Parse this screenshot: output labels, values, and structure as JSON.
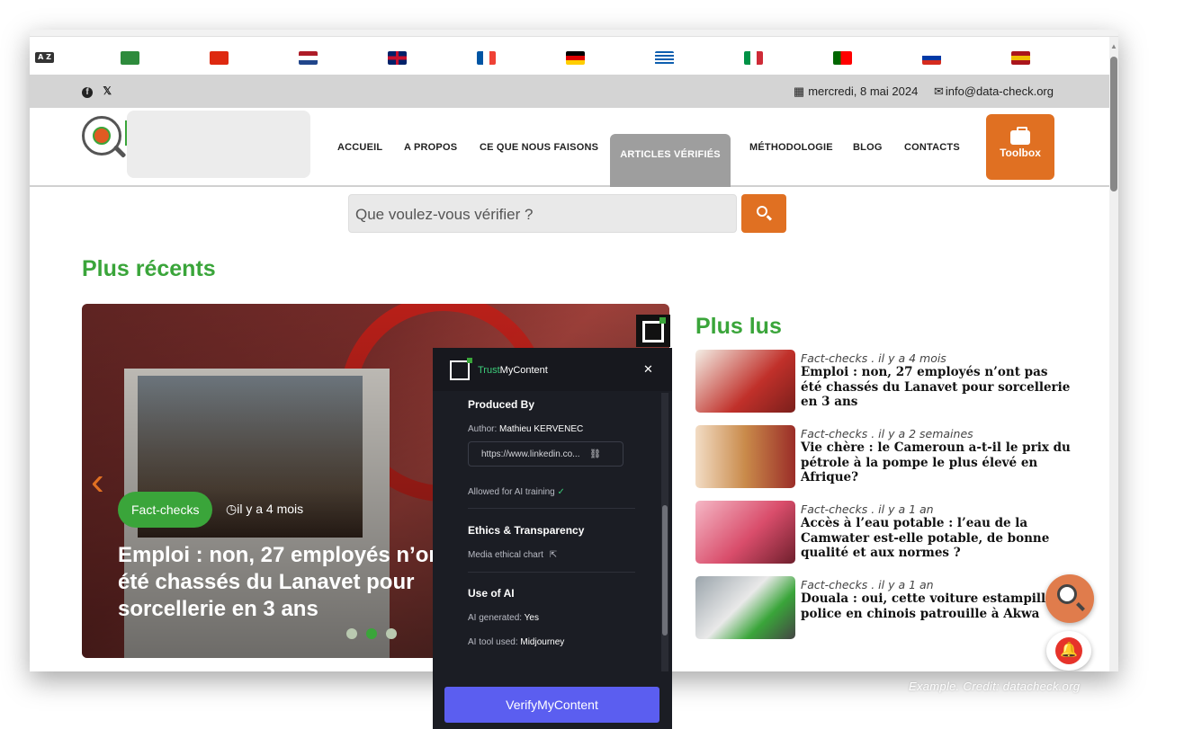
{
  "flags": [
    {
      "name": "arabic-flag",
      "colors": [
        "#2e8b3c",
        "#d9e6d4"
      ]
    },
    {
      "name": "chinese-flag",
      "colors": [
        "#de2910",
        "#ffde00"
      ]
    },
    {
      "name": "dutch-flag",
      "colors": [
        "#ae1c28",
        "#ffffff",
        "#21468b"
      ]
    },
    {
      "name": "uk-flag",
      "colors": [
        "#012169",
        "#ffffff",
        "#c8102e"
      ]
    },
    {
      "name": "french-flag",
      "colors": [
        "#0055a4",
        "#ffffff",
        "#ef4135"
      ]
    },
    {
      "name": "german-flag",
      "colors": [
        "#000000",
        "#dd0000",
        "#ffce00"
      ]
    },
    {
      "name": "greek-flag",
      "colors": [
        "#0d5eaf",
        "#ffffff"
      ]
    },
    {
      "name": "italian-flag",
      "colors": [
        "#009246",
        "#ffffff",
        "#ce2b37"
      ]
    },
    {
      "name": "portuguese-flag",
      "colors": [
        "#006600",
        "#ff0000"
      ]
    },
    {
      "name": "russian-flag",
      "colors": [
        "#ffffff",
        "#0039a6",
        "#d52b1e"
      ]
    },
    {
      "name": "spanish-flag",
      "colors": [
        "#aa151b",
        "#f1bf00",
        "#aa151b"
      ]
    }
  ],
  "lang_toggle": "A Z",
  "topbar": {
    "social": [
      "facebook-icon",
      "x-icon"
    ],
    "date": "mercredi, 8 mai 2024",
    "email": "info@data-check.org"
  },
  "nav": [
    {
      "label": "ACCUEIL"
    },
    {
      "label": "A PROPOS"
    },
    {
      "label": "CE QUE NOUS FAISONS"
    },
    {
      "label": "ARTICLES VÉRIFIÉS",
      "active": true
    },
    {
      "label": "MÉTHODOLOGIE"
    },
    {
      "label": "BLOG"
    },
    {
      "label": "CONTACTS"
    }
  ],
  "toolbox_label": "Toolbox",
  "search": {
    "placeholder": "Que voulez-vous vérifier ?"
  },
  "recent": {
    "heading": "Plus récents",
    "hero": {
      "badge": "Fact-checks",
      "date": "il y a 4 mois",
      "title": "Emploi : non, 27 employés n’ont pas été chassés du Lanavet pour sorcellerie en 3 ans",
      "dots": 3,
      "active_dot": 1
    }
  },
  "popular": {
    "heading": "Plus lus",
    "items": [
      {
        "meta": "Fact-checks . il y a 4 mois",
        "title": "Emploi : non, 27 employés n’ont pas été chassés du Lanavet pour sorcellerie en 3 ans"
      },
      {
        "meta": "Fact-checks . il y a 2 semaines",
        "title": "Vie chère : le Cameroun a-t-il le prix du pétrole à la pompe le plus élevé en Afrique?"
      },
      {
        "meta": "Fact-checks . il y a 1 an",
        "title": "Accès à l’eau potable : l’eau de la Camwater est-elle potable, de bonne qualité et aux normes ?"
      },
      {
        "meta": "Fact-checks . il y a 1 an",
        "title": "Douala : oui, cette voiture estampillée police en chinois patrouille à Akwa"
      }
    ]
  },
  "tmc_panel": {
    "brand_trust": "Trust",
    "brand_rest": "MyContent",
    "produced_by": "Produced By",
    "author_label": "Author:",
    "author": "Mathieu KERVENEC",
    "link": "https://www.linkedin.co...",
    "ai_training": "Allowed for AI training",
    "ethics": "Ethics & Transparency",
    "ethical_chart": "Media ethical chart",
    "use_of_ai": "Use of AI",
    "ai_generated_label": "AI generated:",
    "ai_generated": "Yes",
    "ai_tool_label": "AI tool used:",
    "ai_tool": "Midjourney",
    "verify_button": "VerifyMyContent"
  },
  "credit": "Example. Credit: datacheck.org"
}
